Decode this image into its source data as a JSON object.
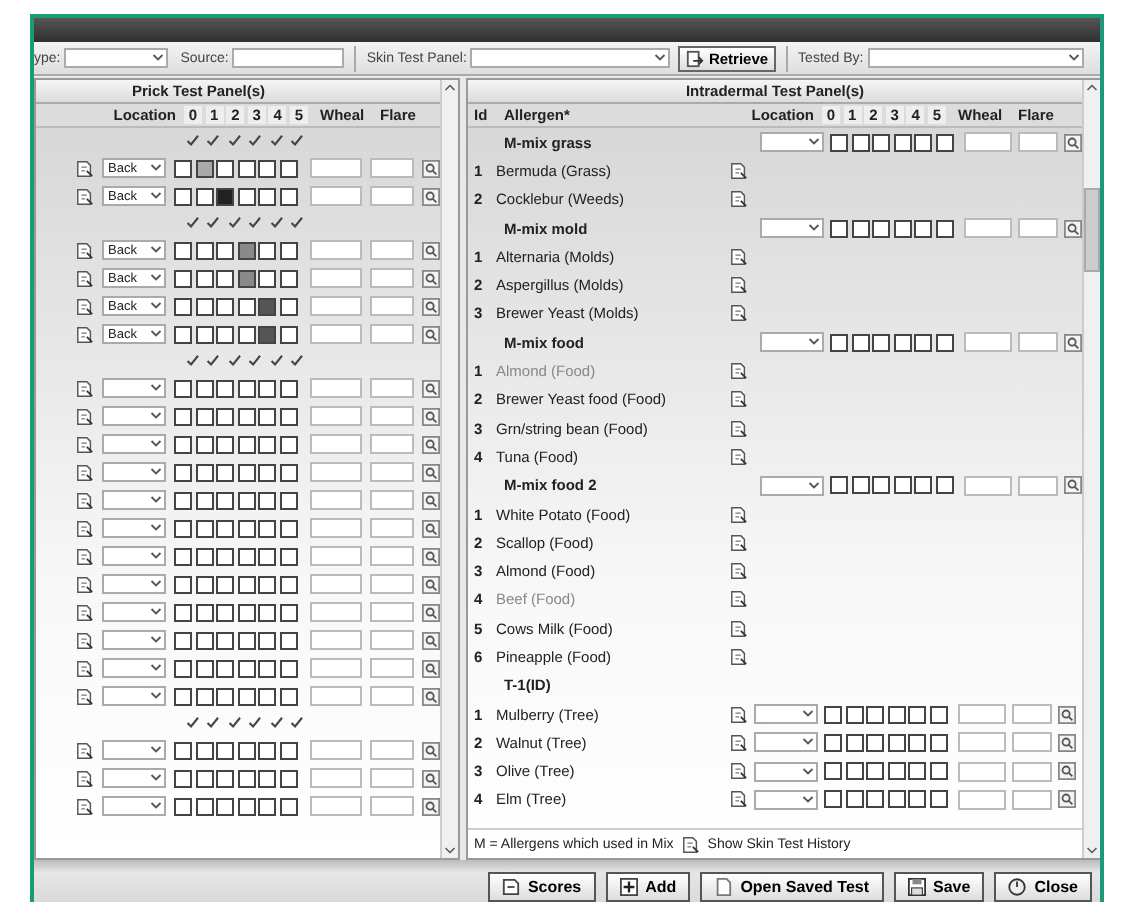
{
  "toolbar": {
    "type_label": "ype:",
    "source_label": "Source:",
    "panel_label": "Skin Test Panel:",
    "retrieve": "Retrieve",
    "tested_by_label": "Tested By:"
  },
  "prick": {
    "title": "Prick Test Panel(s)",
    "columns": [
      "Location",
      "0",
      "1",
      "2",
      "3",
      "4",
      "5",
      "Wheal",
      "Flare"
    ],
    "rows": [
      {
        "kind": "checks"
      },
      {
        "kind": "entry",
        "location": "Back",
        "scores": [
          false,
          true,
          false,
          false,
          false,
          false
        ]
      },
      {
        "kind": "entry",
        "location": "Back",
        "scores": [
          false,
          false,
          true,
          false,
          false,
          false
        ]
      },
      {
        "kind": "checks"
      },
      {
        "kind": "entry",
        "location": "Back",
        "scores": [
          false,
          false,
          false,
          true,
          false,
          false
        ]
      },
      {
        "kind": "entry",
        "location": "Back",
        "scores": [
          false,
          false,
          false,
          true,
          false,
          false
        ]
      },
      {
        "kind": "entry",
        "location": "Back",
        "scores": [
          false,
          false,
          false,
          false,
          true,
          false
        ]
      },
      {
        "kind": "entry",
        "location": "Back",
        "scores": [
          false,
          false,
          false,
          false,
          true,
          false
        ]
      },
      {
        "kind": "checks"
      },
      {
        "kind": "entry",
        "scores": [
          false,
          false,
          false,
          false,
          false,
          false
        ]
      },
      {
        "kind": "entry",
        "scores": [
          false,
          false,
          false,
          false,
          false,
          false
        ]
      },
      {
        "kind": "entry",
        "scores": [
          false,
          false,
          false,
          false,
          false,
          false
        ]
      },
      {
        "kind": "entry",
        "scores": [
          false,
          false,
          false,
          false,
          false,
          false
        ]
      },
      {
        "kind": "entry",
        "scores": [
          false,
          false,
          false,
          false,
          false,
          false
        ]
      },
      {
        "kind": "entry",
        "scores": [
          false,
          false,
          false,
          false,
          false,
          false
        ]
      },
      {
        "kind": "entry",
        "scores": [
          false,
          false,
          false,
          false,
          false,
          false
        ]
      },
      {
        "kind": "entry",
        "scores": [
          false,
          false,
          false,
          false,
          false,
          false
        ]
      },
      {
        "kind": "entry",
        "scores": [
          false,
          false,
          false,
          false,
          false,
          false
        ]
      },
      {
        "kind": "entry",
        "scores": [
          false,
          false,
          false,
          false,
          false,
          false
        ]
      },
      {
        "kind": "entry",
        "scores": [
          false,
          false,
          false,
          false,
          false,
          false
        ]
      },
      {
        "kind": "entry",
        "scores": [
          false,
          false,
          false,
          false,
          false,
          false
        ]
      },
      {
        "kind": "checks"
      },
      {
        "kind": "entry",
        "scores": [
          false,
          false,
          false,
          false,
          false,
          false
        ]
      },
      {
        "kind": "entry",
        "scores": [
          false,
          false,
          false,
          false,
          false,
          false
        ]
      },
      {
        "kind": "entry",
        "scores": [
          false,
          false,
          false,
          false,
          false,
          false
        ]
      }
    ]
  },
  "intradermal": {
    "title": "Intradermal Test Panel(s)",
    "columns": [
      "Id",
      "Allergen*",
      "Location",
      "0",
      "1",
      "2",
      "3",
      "4",
      "5",
      "Wheal",
      "Flare"
    ],
    "rows": [
      {
        "kind": "mix",
        "name": "M-mix  grass",
        "dimmed": false,
        "scores": [
          false,
          false,
          false,
          false,
          false,
          false
        ]
      },
      {
        "kind": "allergen",
        "id": "1",
        "name": "Bermuda (Grass)",
        "dimmed": false
      },
      {
        "kind": "allergen",
        "id": "2",
        "name": "Cocklebur (Weeds)",
        "dimmed": false
      },
      {
        "kind": "mix",
        "name": "M-mix  mold",
        "dimmed": false,
        "scores": [
          false,
          false,
          false,
          false,
          false,
          false
        ]
      },
      {
        "kind": "allergen",
        "id": "1",
        "name": "Alternaria  (Molds)",
        "dimmed": false
      },
      {
        "kind": "allergen",
        "id": "2",
        "name": "Aspergillus  (Molds)",
        "dimmed": false
      },
      {
        "kind": "allergen",
        "id": "3",
        "name": "Brewer Yeast (Molds)",
        "dimmed": false
      },
      {
        "kind": "mix",
        "name": "M-mix food",
        "dimmed": false,
        "scores": [
          false,
          false,
          false,
          false,
          false,
          false
        ]
      },
      {
        "kind": "allergen",
        "id": "1",
        "name": "Almond  (Food)",
        "dimmed": true
      },
      {
        "kind": "allergen",
        "id": "2",
        "name": "Brewer Yeast food (Food)",
        "dimmed": false
      },
      {
        "kind": "allergen",
        "id": "3",
        "name": "Grn/string bean (Food)",
        "dimmed": false
      },
      {
        "kind": "allergen",
        "id": "4",
        "name": "Tuna (Food)",
        "dimmed": false
      },
      {
        "kind": "mix",
        "name": "M-mix food 2",
        "dimmed": false,
        "scores": [
          false,
          false,
          false,
          false,
          false,
          false
        ]
      },
      {
        "kind": "allergen",
        "id": "1",
        "name": "White Potato (Food)",
        "dimmed": false
      },
      {
        "kind": "allergen",
        "id": "2",
        "name": "Scallop (Food)",
        "dimmed": false
      },
      {
        "kind": "allergen",
        "id": "3",
        "name": "Almond  (Food)",
        "dimmed": false
      },
      {
        "kind": "allergen",
        "id": "4",
        "name": "Beef (Food)",
        "dimmed": true
      },
      {
        "kind": "allergen",
        "id": "5",
        "name": "Cows Milk  (Food)",
        "dimmed": false
      },
      {
        "kind": "allergen",
        "id": "6",
        "name": "Pineapple (Food)",
        "dimmed": false
      },
      {
        "kind": "group",
        "name": "T-1(ID)",
        "dimmed": false
      },
      {
        "kind": "scored",
        "id": "1",
        "name": "Mulberry  (Tree)",
        "dimmed": false,
        "scores": [
          false,
          false,
          false,
          false,
          false,
          false
        ]
      },
      {
        "kind": "scored",
        "id": "2",
        "name": "Walnut (Tree)",
        "dimmed": false,
        "scores": [
          false,
          false,
          false,
          false,
          false,
          false
        ]
      },
      {
        "kind": "scored",
        "id": "3",
        "name": "Olive  (Tree)",
        "dimmed": false,
        "scores": [
          false,
          false,
          false,
          false,
          false,
          false
        ]
      },
      {
        "kind": "scored",
        "id": "4",
        "name": "Elm (Tree)",
        "dimmed": false,
        "scores": [
          false,
          false,
          false,
          false,
          false,
          false
        ]
      }
    ]
  },
  "legend": {
    "text": "M = Allergens which used in Mix",
    "history": "Show Skin Test History"
  },
  "buttons": [
    {
      "kind": "scores",
      "label": "Scores"
    },
    {
      "kind": "add",
      "label": "Add"
    },
    {
      "kind": "open",
      "label": "Open Saved Test"
    },
    {
      "kind": "save",
      "label": "Save"
    },
    {
      "kind": "close",
      "label": "Close"
    }
  ]
}
